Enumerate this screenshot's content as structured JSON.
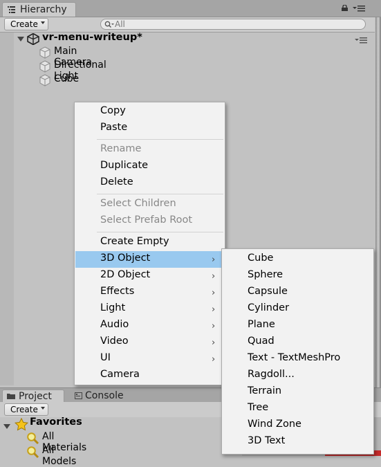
{
  "hierarchy": {
    "tab_label": "Hierarchy",
    "create_label": "Create",
    "search_placeholder": "All",
    "scene_name": "vr-menu-writeup*",
    "objects": [
      "Main Camera",
      "Directional Light",
      "Cube"
    ]
  },
  "project": {
    "tab_label": "Project",
    "console_tab_label": "Console",
    "create_label": "Create",
    "favorites_label": "Favorites",
    "favorites": [
      "All Materials",
      "All Models"
    ]
  },
  "context_menu": {
    "items": [
      {
        "label": "Copy",
        "disabled": false
      },
      {
        "label": "Paste",
        "disabled": false
      },
      {
        "label": "Rename",
        "disabled": true
      },
      {
        "label": "Duplicate",
        "disabled": false
      },
      {
        "label": "Delete",
        "disabled": false
      },
      {
        "label": "Select Children",
        "disabled": true
      },
      {
        "label": "Select Prefab Root",
        "disabled": true
      },
      {
        "label": "Create Empty",
        "disabled": false
      },
      {
        "label": "3D Object",
        "disabled": false,
        "submenu": true,
        "highlighted": true
      },
      {
        "label": "2D Object",
        "disabled": false,
        "submenu": true
      },
      {
        "label": "Effects",
        "disabled": false,
        "submenu": true
      },
      {
        "label": "Light",
        "disabled": false,
        "submenu": true
      },
      {
        "label": "Audio",
        "disabled": false,
        "submenu": true
      },
      {
        "label": "Video",
        "disabled": false,
        "submenu": true
      },
      {
        "label": "UI",
        "disabled": false,
        "submenu": true
      },
      {
        "label": "Camera",
        "disabled": false
      }
    ],
    "submenu_chevron": "›"
  },
  "submenu_3d_object": {
    "items": [
      "Cube",
      "Sphere",
      "Capsule",
      "Cylinder",
      "Plane",
      "Quad",
      "Text - TextMeshPro",
      "Ragdoll...",
      "Terrain",
      "Tree",
      "Wind Zone",
      "3D Text"
    ]
  },
  "colors": {
    "highlight": "#99c9ef",
    "menu_background": "#f2f2f2",
    "panel_background": "#c2c2c2"
  }
}
